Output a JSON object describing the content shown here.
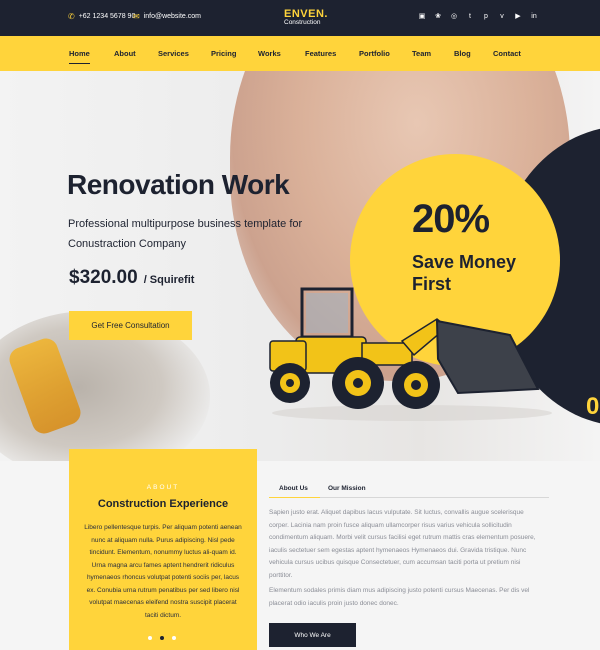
{
  "topbar": {
    "phone": "+62 1234 5678 90",
    "email": "info@website.com",
    "phone_icon": "phone-icon",
    "email_icon": "mail-icon",
    "logo_brand": "ENVEN.",
    "logo_sub": "Construction",
    "social": [
      "flickr-icon",
      "twitter-icon",
      "instagram-icon",
      "tumblr-icon",
      "pinterest-icon",
      "vimeo-icon",
      "youtube-icon",
      "linkedin-icon"
    ]
  },
  "nav": {
    "items": [
      "Home",
      "About",
      "Services",
      "Pricing",
      "Works",
      "Features",
      "Portfolio",
      "Team",
      "Blog",
      "Contact"
    ],
    "active": "Home"
  },
  "hero": {
    "title": "Renovation Work",
    "subtitle": "Professional multipurpose business template for Conustraction Company",
    "price": "$320.00",
    "unit": "/ Squirefit",
    "cta": "Get Free Consultation",
    "discount": "20%",
    "save": "Save Money First",
    "edge_glyph": "0"
  },
  "about": {
    "label": "ABOUT",
    "title": "Construction Experience",
    "text": "Libero pellentesque turpis. Per aliquam potenti aenean nunc at aliquam nulla. Purus adipiscing. Nisl pede tincidunt. Elementum, nonummy luctus ali-quam id. Urna magna arcu fames aptent hendrerit ridiculus hymenaeos rhoncus volutpat potenti sociis per, lacus ex. Conubia urna rutrum penatibus per sed libero nisl volutpat maecenas eleifend nostra suscipit placerat taciti dictum.",
    "active_slide": 2,
    "slide_count": 3
  },
  "tabs": {
    "items": [
      "About Us",
      "Our Mission"
    ],
    "active": "About Us",
    "paragraph1": "Sapien justo erat. Aliquet dapibus lacus vulputate. Sit luctus, convallis augue scelerisque corper. Lacinia nam proin fusce aliquam ullamcorper risus varius vehicula sollicitudin condimentum aliquam. Morbi velit cursus facilisi eget rutrum mattis cras elementum posuere, iaculis sectetuer sem egestas aptent hymenaeos Hymenaeos dui. Gravida tristique. Nunc vehicula cursus ucibus quisque Consectetuer, cum accumsan taciti porta ut pretium nisi porttitor.",
    "paragraph2": "Elementum sodales primis diam mus adipiscing justo potenti cursus Maecenas. Per dis vel placerat odio iaculis proin justo donec donec.",
    "button": "Who We Are"
  },
  "colors": {
    "accent": "#ffd43b",
    "dark": "#1d2230"
  }
}
